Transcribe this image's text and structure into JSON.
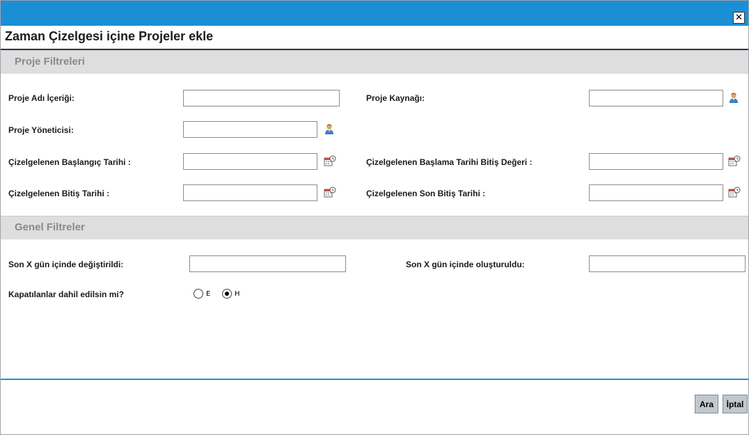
{
  "dialog": {
    "title": "Zaman Çizelgesi içine Projeler ekle",
    "close_label": "✕"
  },
  "project_filters": {
    "heading": "Proje Filtreleri",
    "project_name_label": "Proje Adı İçeriği:",
    "project_name_value": "",
    "project_resource_label": "Proje Kaynağı:",
    "project_resource_value": "",
    "project_manager_label": "Proje Yöneticisi:",
    "project_manager_value": "",
    "sched_start_label": "Çizelgelenen Başlangıç Tarihi :",
    "sched_start_value": "",
    "sched_start_end_label": "Çizelgelenen Başlama Tarihi Bitiş Değeri :",
    "sched_start_end_value": "",
    "sched_finish_label": "Çizelgelenen Bitiş Tarihi :",
    "sched_finish_value": "",
    "sched_last_finish_label": "Çizelgelenen Son Bitiş Tarihi :",
    "sched_last_finish_value": ""
  },
  "general_filters": {
    "heading": "Genel Filtreler",
    "modified_label": "Son X gün içinde değiştirildi:",
    "modified_value": "",
    "created_label": "Son X gün içinde oluşturuldu:",
    "created_value": "",
    "closed_label": "Kapatılanlar dahil edilsin mi?",
    "closed_options": [
      {
        "label": "E",
        "checked": false
      },
      {
        "label": "H",
        "checked": true
      }
    ]
  },
  "footer": {
    "search_button": "Ara",
    "cancel_button": "İptal"
  },
  "icons": {
    "user_picker": "user-picker-icon",
    "date_picker": "calendar-icon"
  },
  "colors": {
    "header_blue": "#1a8fd6",
    "section_bg": "#dedede",
    "button_bg": "#c0c8cf"
  }
}
